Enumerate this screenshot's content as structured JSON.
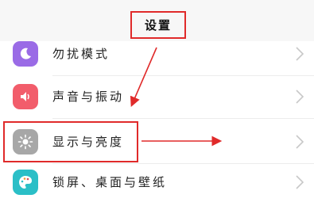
{
  "header": {
    "title": "设置"
  },
  "rows": [
    {
      "label": "勿扰模式",
      "icon": "moon-icon",
      "color": "#9a6be6"
    },
    {
      "label": "声音与振动",
      "icon": "speaker-icon",
      "color": "#f25d6b"
    },
    {
      "label": "显示与亮度",
      "icon": "sun-icon",
      "color": "#a7a7a7"
    },
    {
      "label": "锁屏、桌面与壁纸",
      "icon": "palette-icon",
      "color": "#2bbfc7"
    }
  ],
  "annotation_color": "#e02a2a"
}
